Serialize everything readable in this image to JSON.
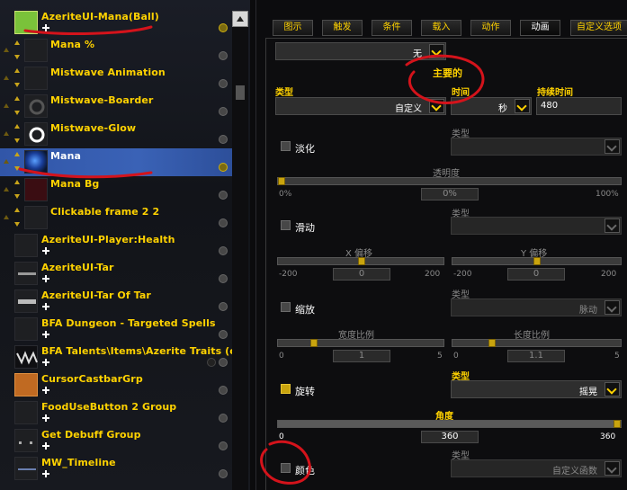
{
  "list": {
    "items": [
      {
        "label": "AzeriteUI-Mana(Ball)",
        "kind": "top",
        "selected": false
      },
      {
        "label": "Mana %",
        "kind": "child"
      },
      {
        "label": "Mistwave Animation",
        "kind": "child"
      },
      {
        "label": "Mistwave-Boarder",
        "kind": "child"
      },
      {
        "label": "Mistwave-Glow",
        "kind": "child"
      },
      {
        "label": "Mana",
        "kind": "child",
        "selected": true
      },
      {
        "label": "Mana Bg",
        "kind": "child"
      },
      {
        "label": "Clickable frame 2 2",
        "kind": "child"
      },
      {
        "label": "AzeriteUI-Player:Health",
        "kind": "top"
      },
      {
        "label": "AzeriteUI-Tar",
        "kind": "top"
      },
      {
        "label": "AzeriteUI-Tar Of Tar",
        "kind": "top"
      },
      {
        "label": "BFA Dungeon - Targeted Spells",
        "kind": "top"
      },
      {
        "label": "BFA Talents\\Items\\Azerite Traits (cur...",
        "kind": "top"
      },
      {
        "label": "CursorCastbarGrp",
        "kind": "top"
      },
      {
        "label": "FoodUseButton 2 Group",
        "kind": "top"
      },
      {
        "label": "Get Debuff Group",
        "kind": "top"
      },
      {
        "label": "MW_Timeline",
        "kind": "top"
      }
    ]
  },
  "tabs": [
    "图示",
    "触发",
    "条件",
    "载入",
    "动作",
    "动画",
    "自定义选项"
  ],
  "active_tab": "动画",
  "options": {
    "top_select": "无",
    "main_header": "主要的",
    "type_label": "类型",
    "type_value": "自定义",
    "time_label": "时间",
    "time_value": "秒",
    "duration_label": "持续时间",
    "duration_value": "480",
    "fade": {
      "label": "淡化",
      "type_label": "类型",
      "alpha_label": "透明度",
      "alpha_min": "0%",
      "alpha_value": "0%",
      "alpha_max": "100%"
    },
    "translate": {
      "label": "滑动",
      "type_label": "类型",
      "x_label": "X 偏移",
      "x_min": "-200",
      "x_value": "0",
      "x_max": "200",
      "y_label": "Y 偏移",
      "y_min": "-200",
      "y_value": "0",
      "y_max": "200"
    },
    "scale": {
      "label": "缩放",
      "type_label": "类型",
      "type_value": "脉动",
      "w_label": "宽度比例",
      "w_min": "0",
      "w_value": "1",
      "w_max": "5",
      "h_label": "长度比例",
      "h_min": "0",
      "h_value": "1.1",
      "h_max": "5"
    },
    "rotate": {
      "label": "旋转",
      "type_label": "类型",
      "type_value": "摇晃",
      "angle_label": "角度",
      "angle_min": "0",
      "angle_value": "360",
      "angle_max": "360"
    },
    "color": {
      "label": "颜色",
      "type_label": "类型",
      "type_value": "自定义函数"
    }
  }
}
